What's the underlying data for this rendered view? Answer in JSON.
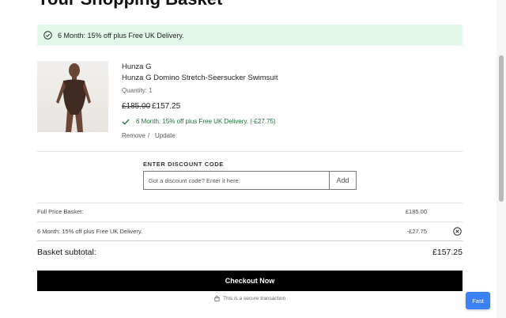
{
  "page": {
    "title": "Your Shopping Basket"
  },
  "promo_banner": {
    "text": "6 Month: 15% off plus Free UK Delivery.",
    "icon": "circle-check-icon"
  },
  "item": {
    "image_alt": "Hunza G Domino Stretch-Seersucker Swimsuit",
    "brand": "Hunza G",
    "name": "Hunza G Domino Stretch-Seersucker Swimsuit",
    "quantity": "Quantity: 1",
    "price_old": "£185.00",
    "price_new": "£157.25",
    "offer": "6 Month: 15% off plus Free UK Delivery.  (-£27.75)",
    "remove_label": "Remove",
    "separator": "/",
    "update_label": "Update"
  },
  "discount": {
    "label": "ENTER DISCOUNT CODE",
    "placeholder": "Got a discount code? Enter it here:",
    "add_label": "Add"
  },
  "summary": {
    "full_price_label": "Full Price Basket:",
    "full_price_value": "£185.00",
    "discount_label": "6 Month: 15% off plus Free UK Delivery.",
    "discount_value": "-£27.75",
    "subtotal_label": "Basket subtotal:",
    "subtotal_value": "£157.25"
  },
  "checkout": {
    "label": "Checkout Now",
    "secure_note": "This is a secure transaction"
  },
  "fast_button": {
    "label": "Fast"
  },
  "colors": {
    "banner_bg": "#e3f7ea",
    "offer_text": "#1f6b3a",
    "checkout_bg": "#000000",
    "fast_bg": "#3b82f6"
  }
}
